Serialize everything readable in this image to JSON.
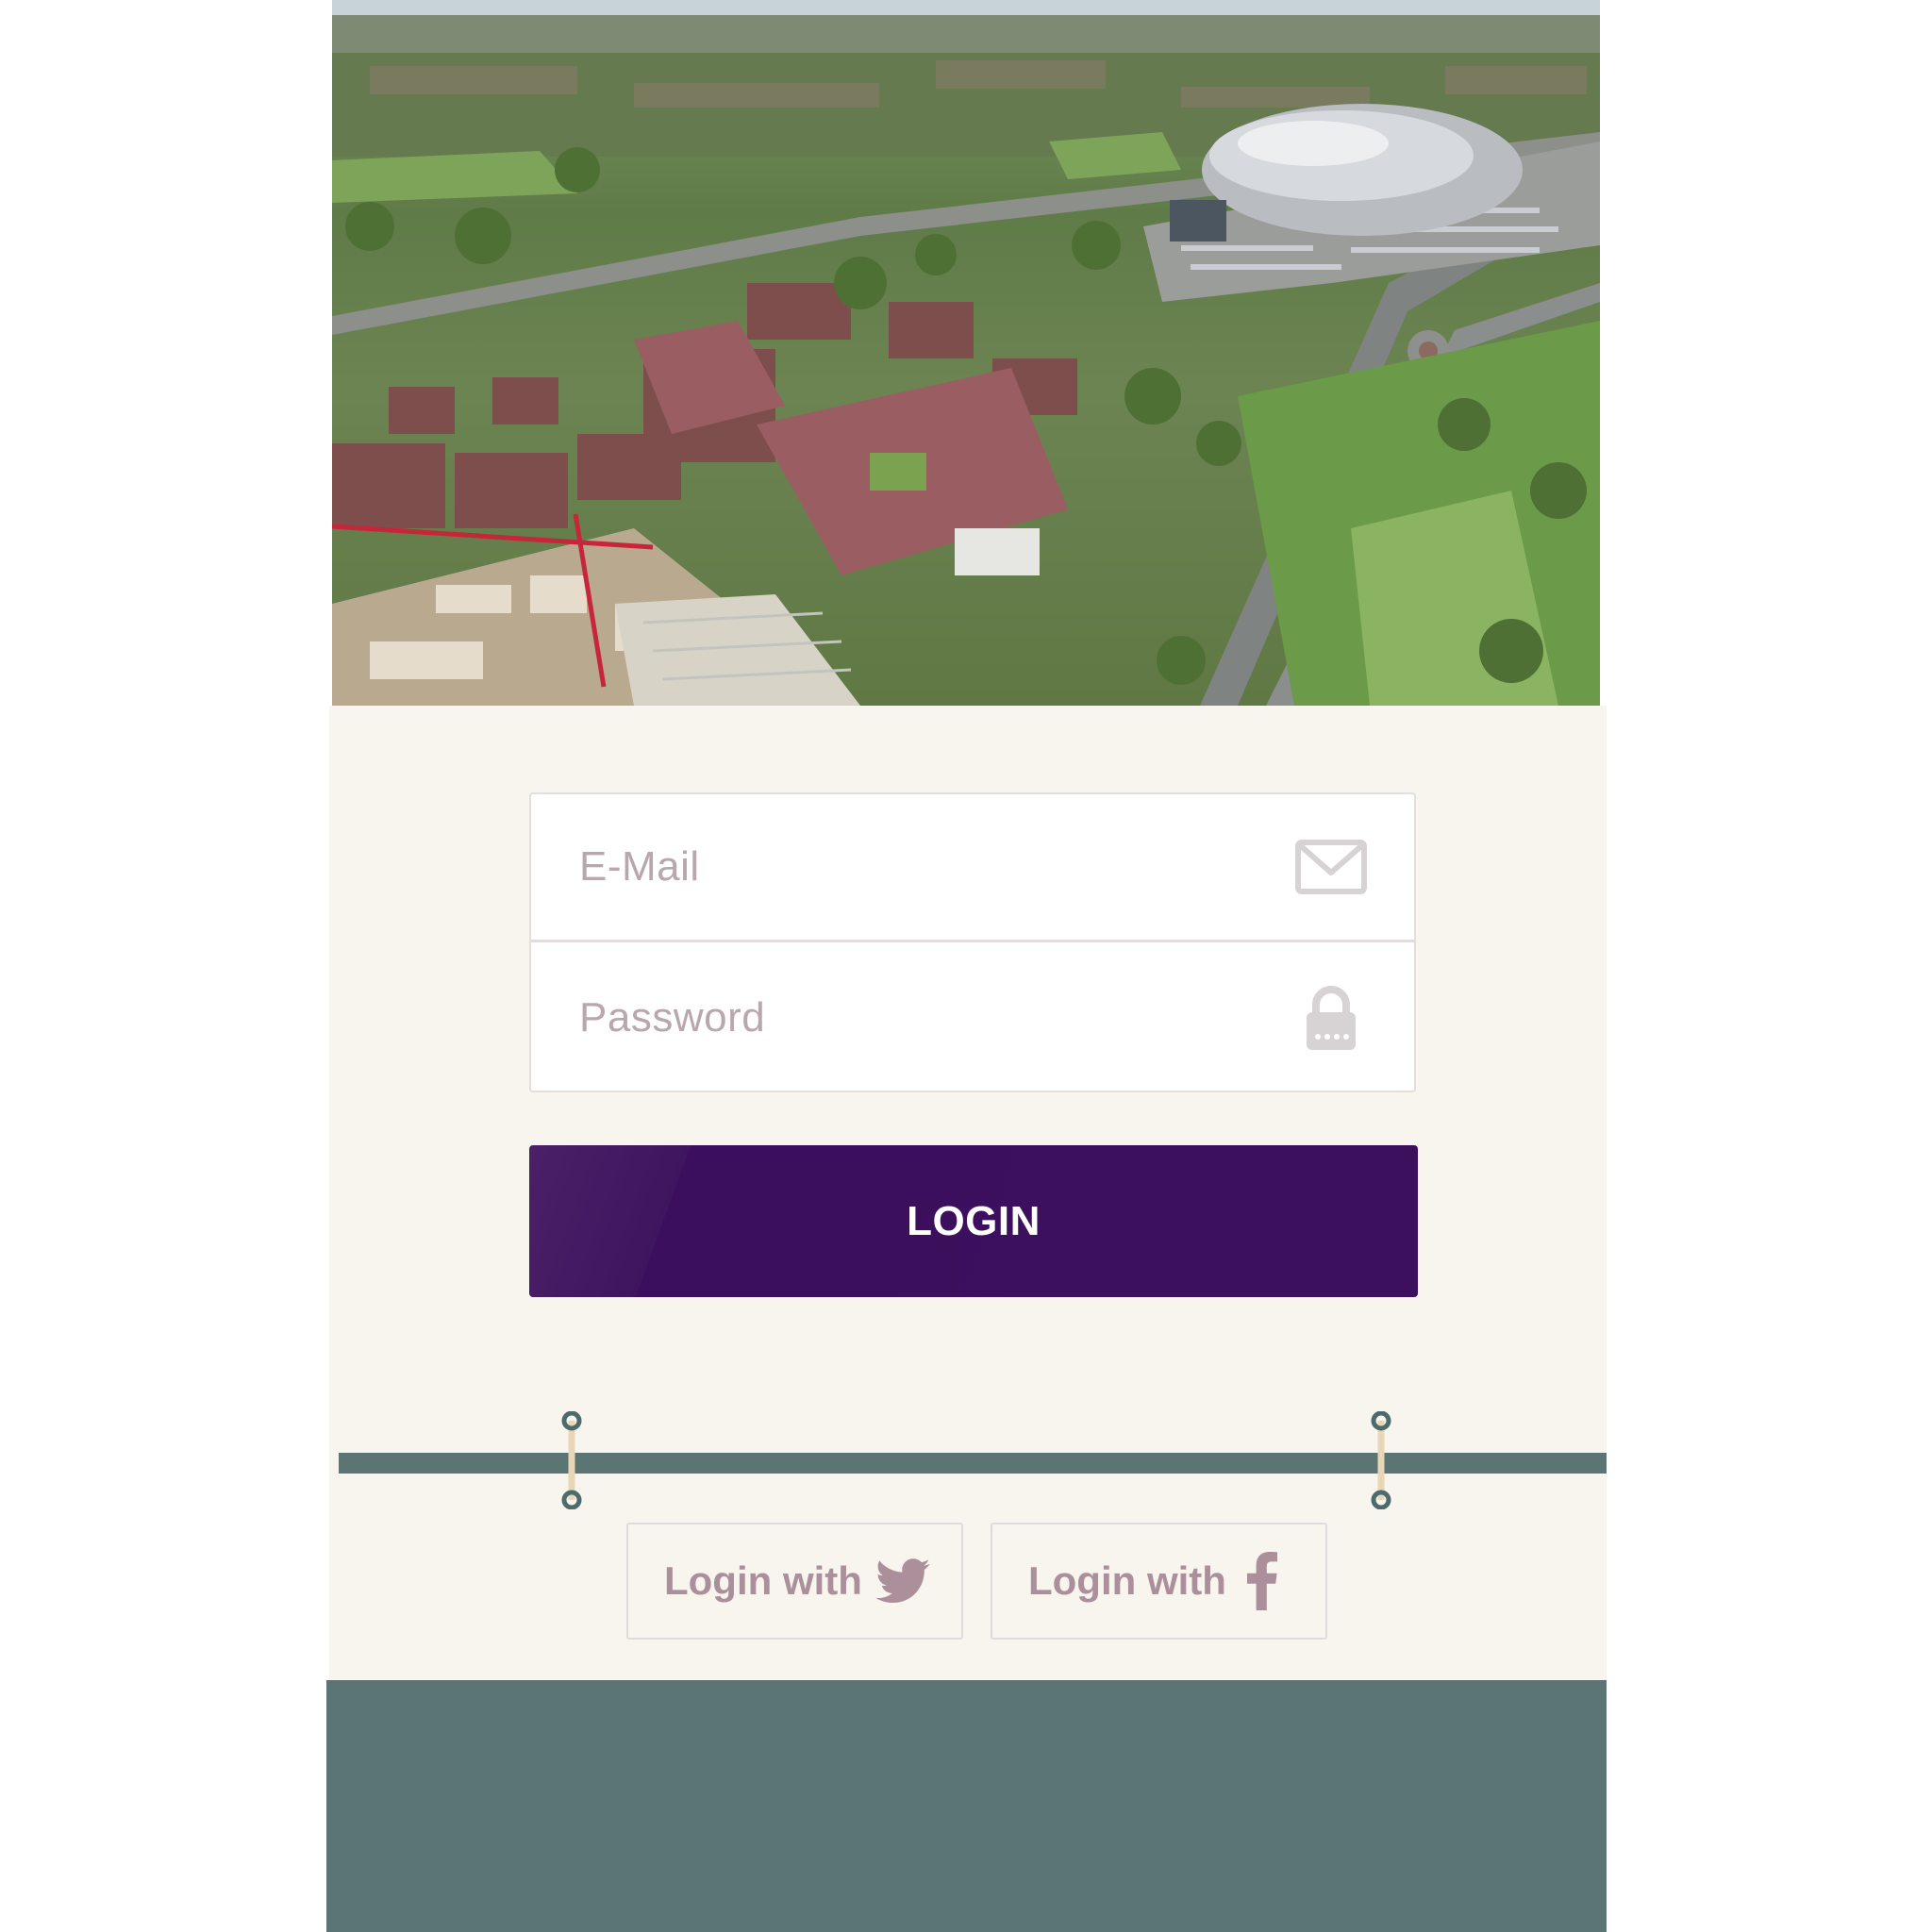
{
  "hero": {
    "image": "aerial-city-view"
  },
  "login_form": {
    "email": {
      "placeholder": "E-Mail",
      "icon": "envelope-icon"
    },
    "password": {
      "placeholder": "Password",
      "icon": "lock-icon"
    },
    "submit_label": "LOGIN"
  },
  "social_login": {
    "twitter": {
      "label": "Login with",
      "icon": "twitter-bird-icon"
    },
    "facebook": {
      "label": "Login with",
      "icon": "facebook-f-icon"
    }
  },
  "colors": {
    "panel_bg": "#f8f5ef",
    "accent_purple": "#3c105d",
    "teal": "#5b7574",
    "placeholder_text": "#b9a7ae",
    "social_text": "#ab8f9a"
  }
}
